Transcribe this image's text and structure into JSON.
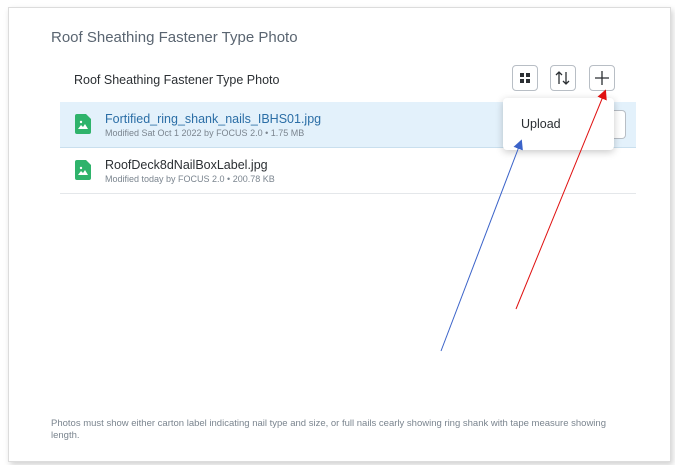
{
  "section": {
    "title": "Roof Sheathing Fastener Type Photo"
  },
  "panel": {
    "title": "Roof Sheathing Fastener Type Photo"
  },
  "toolbar": {
    "grid_icon": "grid-view-icon",
    "sort_icon": "sort-icon",
    "add_icon": "plus-icon"
  },
  "files": [
    {
      "name": "Fortified_ring_shank_nails_IBHS01.jpg",
      "meta": "Modified Sat Oct 1 2022 by FOCUS 2.0 • 1.75 MB",
      "selected": true
    },
    {
      "name": "RoofDeck8dNailBoxLabel.jpg",
      "meta": "Modified today by FOCUS 2.0 • 200.78 KB",
      "selected": false
    }
  ],
  "dropdown": {
    "upload_label": "Upload"
  },
  "footer": {
    "note": "Photos must show either carton label indicating nail type and size, or full nails cearly showing ring shank with tape measure showing length."
  },
  "colors": {
    "file_icon": "#2fb36b",
    "accent": "#2b6ea6",
    "selected_bg": "#e3f1fb",
    "arrow_blue": "#3b63c9",
    "arrow_red": "#e01010"
  }
}
